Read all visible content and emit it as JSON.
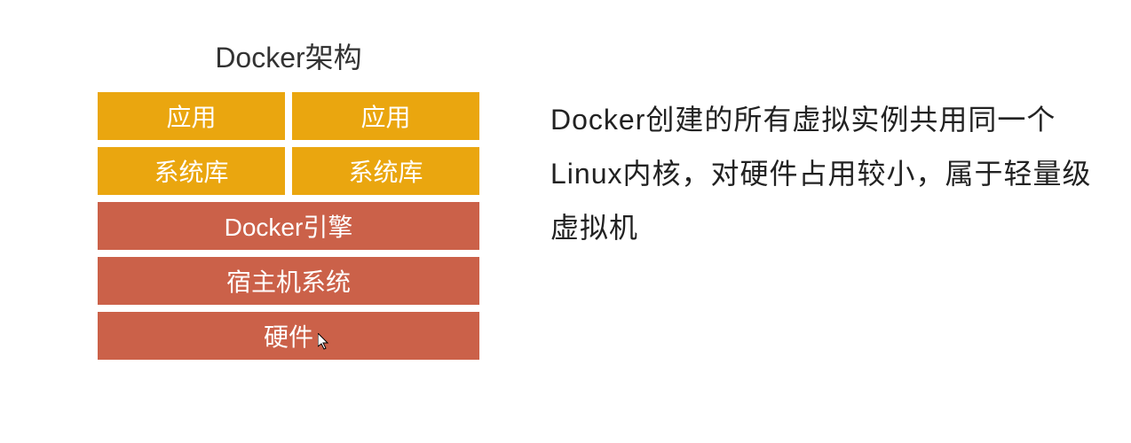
{
  "diagram": {
    "title": "Docker架构",
    "rows": {
      "app_left": "应用",
      "app_right": "应用",
      "lib_left": "系统库",
      "lib_right": "系统库",
      "engine": "Docker引擎",
      "host_os": "宿主机系统",
      "hardware": "硬件"
    }
  },
  "description": "Docker创建的所有虚拟实例共用同一个Linux内核，对硬件占用较小，属于轻量级虚拟机",
  "colors": {
    "orange": "#eaa60f",
    "brick": "#cb6149"
  }
}
